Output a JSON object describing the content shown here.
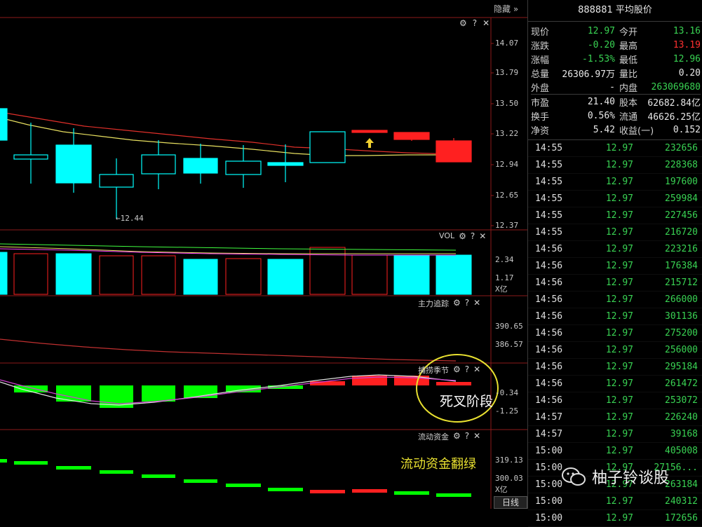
{
  "toolbar": {
    "hide_label": "隐藏"
  },
  "main_panel": {
    "price_ticks": [
      "14.07",
      "13.79",
      "13.50",
      "13.22",
      "12.94",
      "12.65",
      "12.37"
    ],
    "low_marker": "←12.44",
    "controls": [
      "⚙",
      "?",
      "✕"
    ]
  },
  "vol_panel": {
    "title": "VOL",
    "ticks": [
      "2.34",
      "1.17",
      "X亿"
    ]
  },
  "mf_panel": {
    "title": "主力追踪",
    "ticks": [
      "390.65",
      "386.57"
    ]
  },
  "season_panel": {
    "title": "捕捞季节",
    "ticks": [
      "-0.34",
      "-1.25"
    ]
  },
  "flow_panel": {
    "title": "流动资金",
    "ticks": [
      "319.13",
      "300.03",
      "X亿"
    ]
  },
  "annotations": {
    "death_cross": "死叉阶段",
    "flow_green": "流动资金翻绿",
    "watermark": "柚子铃谈股"
  },
  "bottom_tab": "日线",
  "colors": {
    "up": "#ff2020",
    "down": "#00ffff",
    "green_bar": "#00ff00",
    "ma_red": "#e0302a",
    "ma_yellow": "#e8e060"
  },
  "quote": {
    "header": "888881 平均股价",
    "rows": [
      {
        "l1": "现价",
        "v1": "12.97",
        "c1": "green",
        "l2": "今开",
        "v2": "13.16",
        "c2": "green"
      },
      {
        "l1": "涨跌",
        "v1": "-0.20",
        "c1": "green",
        "l2": "最高",
        "v2": "13.19",
        "c2": "red"
      },
      {
        "l1": "涨幅",
        "v1": "-1.53%",
        "c1": "green",
        "l2": "最低",
        "v2": "12.96",
        "c2": "green"
      },
      {
        "l1": "总量",
        "v1": "26306.97万",
        "c1": "white",
        "l2": "量比",
        "v2": "0.20",
        "c2": "white"
      },
      {
        "l1": "外盘",
        "v1": "-",
        "c1": "white",
        "l2": "内盘",
        "v2": "263069680",
        "c2": "green"
      },
      {
        "l1": "市盈",
        "v1": "21.40",
        "c1": "white",
        "l2": "股本",
        "v2": "62682.84亿",
        "c2": "white"
      },
      {
        "l1": "换手",
        "v1": "0.56%",
        "c1": "white",
        "l2": "流通",
        "v2": "46626.25亿",
        "c2": "white"
      },
      {
        "l1": "净资",
        "v1": "5.42",
        "c1": "white",
        "l2": "收益(一)",
        "v2": "0.152",
        "c2": "white"
      }
    ]
  },
  "ticks": [
    {
      "t": "14:55",
      "p": "12.97",
      "v": "232656"
    },
    {
      "t": "14:55",
      "p": "12.97",
      "v": "228368"
    },
    {
      "t": "14:55",
      "p": "12.97",
      "v": "197600"
    },
    {
      "t": "14:55",
      "p": "12.97",
      "v": "259984"
    },
    {
      "t": "14:55",
      "p": "12.97",
      "v": "227456"
    },
    {
      "t": "14:55",
      "p": "12.97",
      "v": "216720"
    },
    {
      "t": "14:56",
      "p": "12.97",
      "v": "223216"
    },
    {
      "t": "14:56",
      "p": "12.97",
      "v": "176384"
    },
    {
      "t": "14:56",
      "p": "12.97",
      "v": "215712"
    },
    {
      "t": "14:56",
      "p": "12.97",
      "v": "266000"
    },
    {
      "t": "14:56",
      "p": "12.97",
      "v": "301136"
    },
    {
      "t": "14:56",
      "p": "12.97",
      "v": "275200"
    },
    {
      "t": "14:56",
      "p": "12.97",
      "v": "256000"
    },
    {
      "t": "14:56",
      "p": "12.97",
      "v": "295184"
    },
    {
      "t": "14:56",
      "p": "12.97",
      "v": "261472"
    },
    {
      "t": "14:56",
      "p": "12.97",
      "v": "253072"
    },
    {
      "t": "14:57",
      "p": "12.97",
      "v": "226240"
    },
    {
      "t": "14:57",
      "p": "12.97",
      "v": "39168"
    },
    {
      "t": "15:00",
      "p": "12.97",
      "v": "405008"
    },
    {
      "t": "15:00",
      "p": "12.97",
      "v": "27156..."
    },
    {
      "t": "15:00",
      "p": "12.97",
      "v": "263184"
    },
    {
      "t": "15:00",
      "p": "12.97",
      "v": "240312"
    },
    {
      "t": "15:00",
      "p": "12.97",
      "v": "172656"
    }
  ]
}
